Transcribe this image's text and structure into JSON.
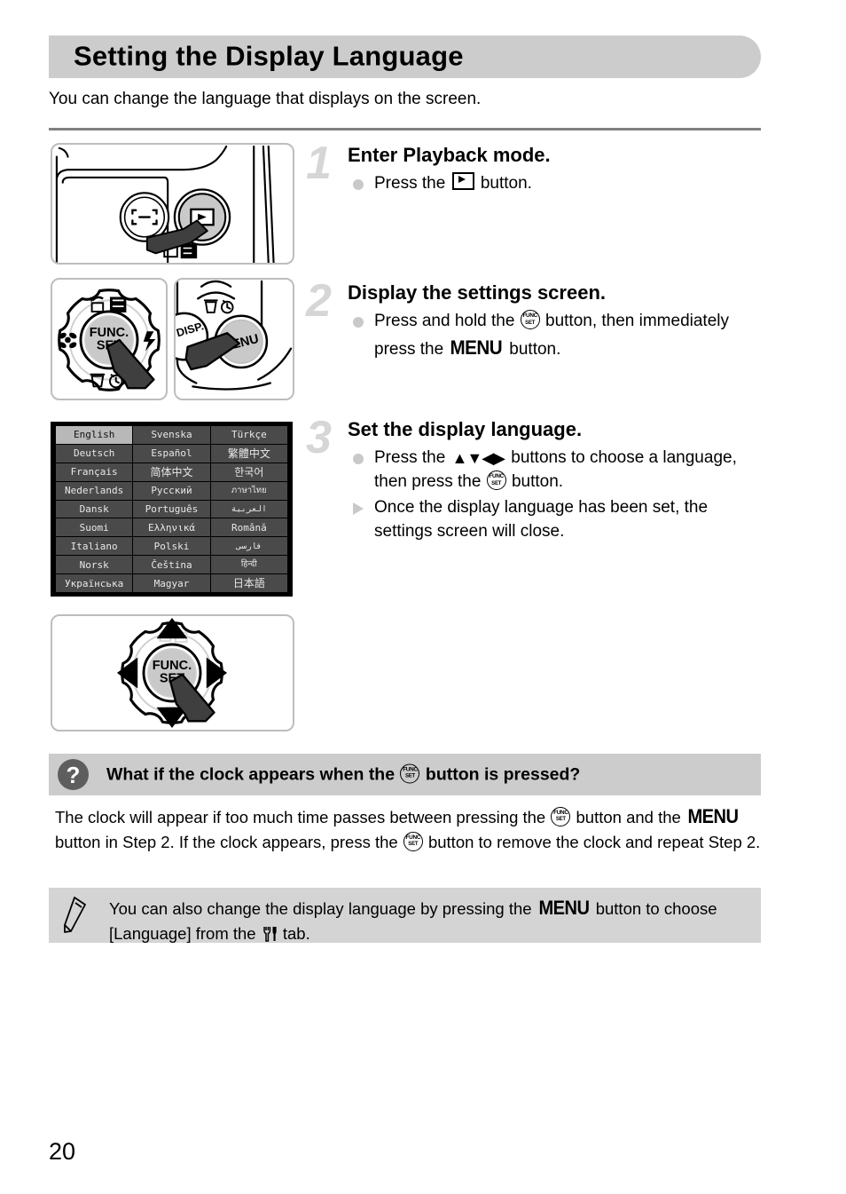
{
  "header": {
    "title": "Setting the Display Language"
  },
  "intro": {
    "text": "You can change the language that displays on the screen."
  },
  "steps": [
    {
      "number": "1",
      "title": "Enter Playback mode.",
      "lines": [
        {
          "marker": "dot",
          "pre": "Press the ",
          "icon": "playback-icon",
          "post": " button."
        }
      ]
    },
    {
      "number": "2",
      "title": "Display the settings screen.",
      "lines": [
        {
          "marker": "dot",
          "pre": "Press and hold the ",
          "icon": "func-set-icon",
          "mid": " button, then immediately press the ",
          "menu": "MENU",
          "post": " button."
        }
      ]
    },
    {
      "number": "3",
      "title": "Set the display language.",
      "lines": [
        {
          "marker": "dot",
          "pre": "Press the ",
          "arrows": "▲▼◀▶",
          "mid": " buttons to choose a language, then press the ",
          "icon": "func-set-icon",
          "post": " button."
        },
        {
          "marker": "triangle",
          "pre": "Once the display language has been set, the settings screen will close."
        }
      ]
    }
  ],
  "language_screen": {
    "selected": "English",
    "columns": [
      [
        "English",
        "Deutsch",
        "Français",
        "Nederlands",
        "Dansk",
        "Suomi",
        "Italiano",
        "Norsk",
        "Українська"
      ],
      [
        "Svenska",
        "Español",
        "简体中文",
        "Русский",
        "Português",
        "Ελληνικά",
        "Polski",
        "Čeština",
        "Magyar"
      ],
      [
        "Türkçe",
        "繁體中文",
        "한국어",
        "ภาษาไทย",
        "العربية",
        "Română",
        "فارسی",
        "हिन्दी",
        "日本語"
      ]
    ]
  },
  "figures": {
    "fig1_caption": "camera-back-playback-button",
    "fig2_caption": "control-dial-func-set",
    "fig3_caption": "menu-button",
    "fig4_caption": "control-dial-arrows",
    "labels": {
      "func": "FUNC.",
      "set": "SET",
      "menu": "MENU",
      "disp": "DISP."
    }
  },
  "question": {
    "icon": "?",
    "title_pre": "What if the clock appears when the ",
    "title_icon": "func-set-icon",
    "title_post": " button is pressed?",
    "body_1": "The clock will appear if too much time passes between pressing the ",
    "body_2": " button and the ",
    "body_menu": "MENU",
    "body_3": " button in Step 2. If the clock appears, press the ",
    "body_4": " button to remove the clock and repeat Step 2."
  },
  "note": {
    "icon": "pencil-icon",
    "text_1": "You can also change the display language by pressing the ",
    "menu": "MENU",
    "text_2": " button to choose [Language] from the ",
    "tab_icon": "settings-tab-icon",
    "text_3": " tab."
  },
  "footer": {
    "page_number": "20"
  },
  "colors": {
    "header_band": "#cccccc",
    "note_band": "#d4d4d4",
    "step_number": "#d6d6d6",
    "marker": "#c9c9c9",
    "screen_bg": "#000000",
    "cell_bg": "#4a4a4a",
    "cell_selected": "#b8b8b8"
  }
}
